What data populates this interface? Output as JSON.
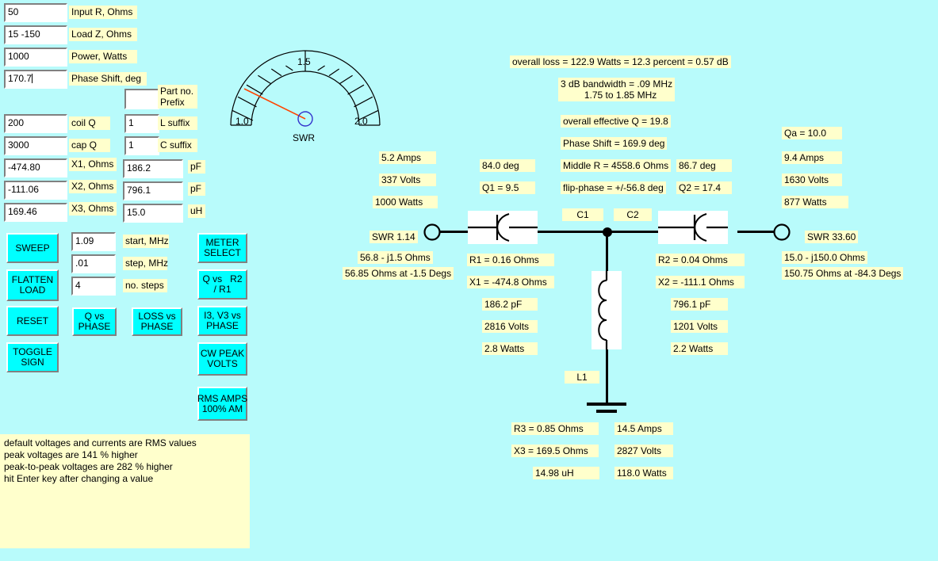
{
  "colors": {
    "background": "#b8fbfb",
    "label_bg": "#ffffcc",
    "button_bg": "#00ffff",
    "needle": "#ff4400",
    "hub": "#3333cc"
  },
  "inputs": {
    "input_r": {
      "value": "50",
      "label": "Input R, Ohms"
    },
    "load_z": {
      "value": "15 -150",
      "label": "Load Z, Ohms"
    },
    "power": {
      "value": "1000",
      "label": "Power, Watts"
    },
    "phase_shift": {
      "value": "170.7",
      "label": "Phase Shift, deg",
      "focused": true
    },
    "part_prefix": {
      "value": "",
      "label": "Part no.\nPrefix"
    },
    "coil_q": {
      "value": "200",
      "label": "coil Q"
    },
    "cap_q": {
      "value": "3000",
      "label": "cap Q"
    },
    "l_suffix": {
      "value": "1",
      "label": "L suffix"
    },
    "c_suffix": {
      "value": "1",
      "label": "C suffix"
    },
    "x1": {
      "value": "-474.80",
      "label": "X1, Ohms",
      "conv_value": "186.2",
      "conv_unit": "pF"
    },
    "x2": {
      "value": "-111.06",
      "label": "X2, Ohms",
      "conv_value": "796.1",
      "conv_unit": "pF"
    },
    "x3": {
      "value": "169.46",
      "label": "X3, Ohms",
      "conv_value": "15.0",
      "conv_unit": "uH"
    },
    "start_mhz": {
      "value": "1.09",
      "label": "start, MHz"
    },
    "step_mhz": {
      "value": ".01",
      "label": "step, MHz"
    },
    "no_steps": {
      "value": "4",
      "label": "no. steps"
    }
  },
  "buttons": {
    "sweep": "SWEEP",
    "flatten_load": "FLATTEN\nLOAD",
    "reset": "RESET",
    "toggle_sign": "TOGGLE\nSIGN",
    "q_vs_phase": "Q vs\nPHASE",
    "loss_vs_phase": "LOSS vs\nPHASE",
    "meter_select": "METER\nSELECT",
    "q_vs_r2_r1": "Q vs   R2\n/ R1",
    "i3_v3_vs_phase": "I3, V3 vs\nPHASE",
    "cw_peak_volts": "CW PEAK\nVOLTS",
    "rms_amps": "RMS AMPS\n100% AM"
  },
  "notes": "default voltages and currents are RMS values\npeak voltages are 141 % higher\npeak-to-peak voltages are 282 % higher\nhit Enter key after changing a value",
  "meter": {
    "title": "SWR",
    "min_label": "1.0",
    "mid_label": "1.5",
    "max_label": "2.0",
    "segments": 10,
    "value": 1.14
  },
  "summary": {
    "overall_loss": "overall loss = 122.9 Watts = 12.3 percent = 0.57 dB",
    "bandwidth": "3 dB bandwidth = .09 MHz\n   1.75 to 1.85 MHz",
    "effective_q": "overall effective Q = 19.8",
    "phase_shift": "Phase Shift = 169.9 deg",
    "middle_r": "Middle R = 4558.6 Ohms",
    "flip_phase": "flip-phase = +/-56.8 deg"
  },
  "source": {
    "amps": "5.2 Amps",
    "volts": "337 Volts",
    "watts": "1000 Watts",
    "swr": "SWR 1.14",
    "impedance": "56.8 - j1.5 Ohms",
    "polar": "56.85 Ohms at -1.5 Degs"
  },
  "stage1": {
    "deg": "84.0 deg",
    "q": "Q1 = 9.5",
    "cap_label": "C1",
    "r": "R1 = 0.16 Ohms",
    "x": "X1 = -474.8 Ohms",
    "value": "186.2 pF",
    "volts": "2816 Volts",
    "watts": "2.8 Watts"
  },
  "stage2": {
    "deg": "86.7 deg",
    "q": "Q2 = 17.4",
    "cap_label": "C2",
    "r": "R2 = 0.04 Ohms",
    "x": "X2 = -111.1 Ohms",
    "value": "796.1 pF",
    "volts": "1201 Volts",
    "watts": "2.2 Watts"
  },
  "shunt": {
    "ind_label": "L1",
    "r": "R3 = 0.85 Ohms",
    "x": "X3 = 169.5 Ohms",
    "value": "14.98 uH",
    "amps": "14.5 Amps",
    "volts": "2827 Volts",
    "watts": "118.0 Watts"
  },
  "load": {
    "qa": "Qa = 10.0",
    "amps": "9.4 Amps",
    "volts": "1630 Volts",
    "watts": "877 Watts",
    "swr": "SWR 33.60",
    "impedance": "15.0 - j150.0 Ohms",
    "polar": "150.75 Ohms at -84.3 Degs"
  }
}
